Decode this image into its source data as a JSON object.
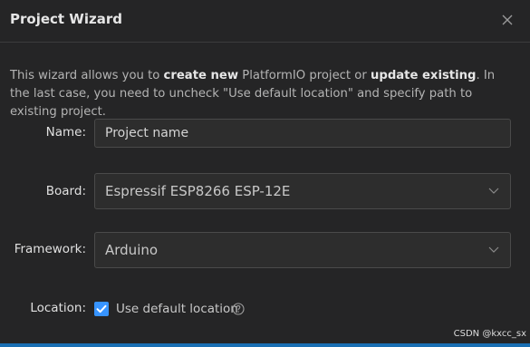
{
  "dialog": {
    "title": "Project Wizard",
    "close_icon": "close-icon"
  },
  "description": {
    "part1": "This wizard allows you to ",
    "bold1": "create new",
    "part2": " PlatformIO project or ",
    "bold2": "update existing",
    "part3": ". In the last case, you need to uncheck \"Use default location\" and specify path to existing project."
  },
  "form": {
    "name_label": "Name",
    "name_value": "Project name",
    "board_label": "Board",
    "board_value": "Espressif ESP8266 ESP-12E",
    "framework_label": "Framework",
    "framework_value": "Arduino",
    "location_label": "Location",
    "use_default_location_label": "Use default location",
    "use_default_location_checked": true,
    "separator": ":"
  },
  "watermark": "CSDN @kxcc_sx",
  "colors": {
    "background": "#252526",
    "accent": "#3794ff",
    "bottom_bar": "#1a6fb3"
  }
}
